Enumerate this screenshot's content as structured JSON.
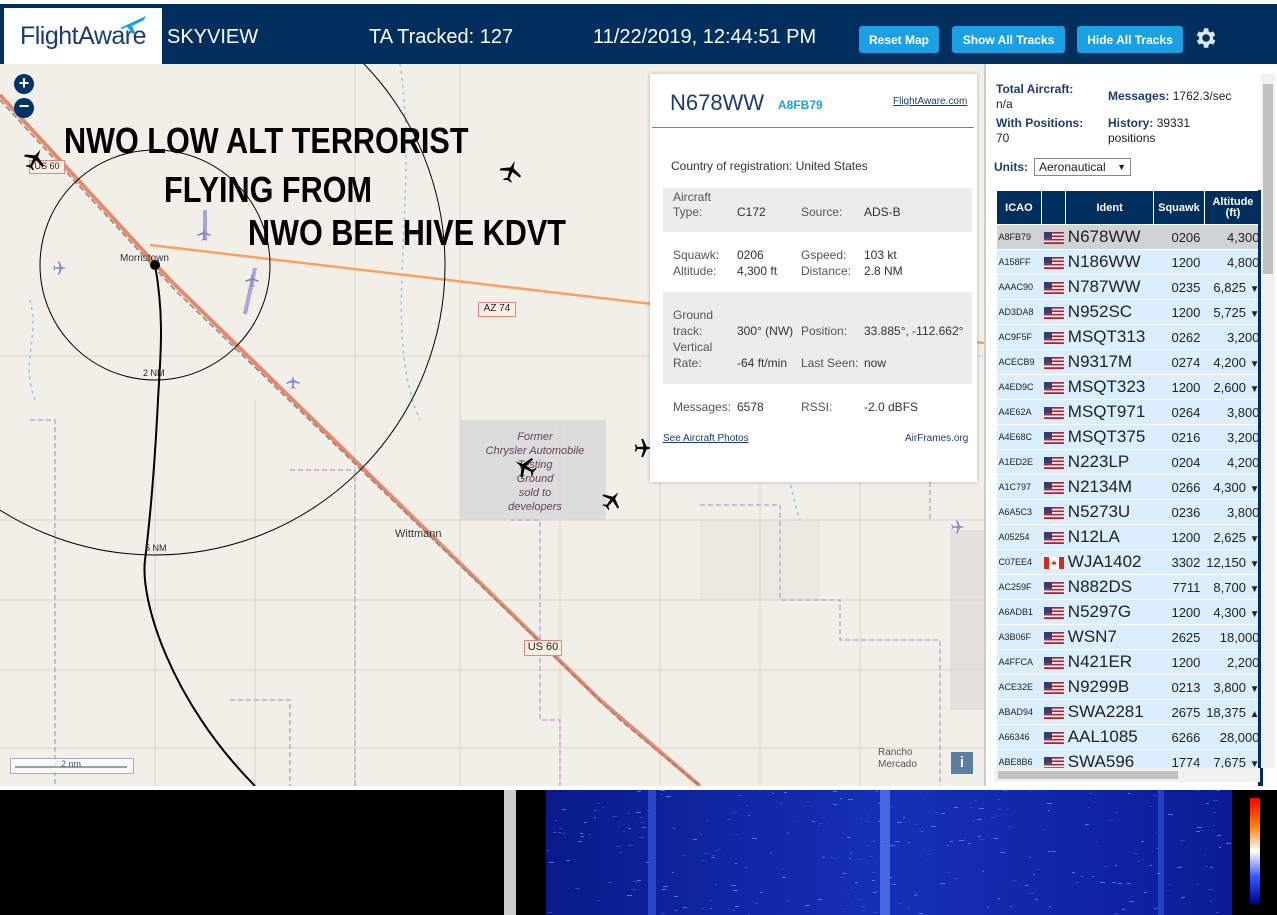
{
  "header": {
    "logo": "FlightAware",
    "title": "SKYVIEW",
    "tracked": "TA Tracked: 127",
    "datetime": "11/22/2019, 12:44:51 PM",
    "buttons": {
      "reset": "Reset Map",
      "show": "Show All Tracks",
      "hide": "Hide All Tracks"
    }
  },
  "map": {
    "overlay_text": [
      "NWO LOW ALT TERRORIST",
      "FLYING FROM",
      "NWO BEE HIVE KDVT"
    ],
    "places": {
      "morristown": "Morristown",
      "wittmann": "Wittmann",
      "rancho": "Rancho",
      "mercado": "Mercado"
    },
    "poi": [
      "Former",
      "Chrysler Automobile",
      "Testing",
      "Ground",
      "sold to",
      "developers"
    ],
    "shields": {
      "us60_top": "US 60",
      "az74": "AZ 74",
      "us60_bottom": "US 60"
    },
    "rings": {
      "r2": "2 NM",
      "r5": "5 NM"
    },
    "scale": "2 nm",
    "info_button": "i"
  },
  "popup": {
    "callsign": "N678WW",
    "icao": "A8FB79",
    "link": "FlightAware.com",
    "country_label": "Country of registration:",
    "country": "United States",
    "aircraft_label": "Aircraft",
    "type_label": "Type:",
    "type": "C172",
    "source_label": "Source:",
    "source": "ADS-B",
    "squawk_label": "Squawk:",
    "squawk": "0206",
    "gspeed_label": "Gspeed:",
    "gspeed": "103 kt",
    "altitude_label": "Altitude:",
    "altitude": "4,300 ft",
    "distance_label": "Distance:",
    "distance": "2.8 NM",
    "ground_label": "Ground",
    "track_label": "track:",
    "track": "300° (NW)",
    "position_label": "Position:",
    "position": "33.885°, -112.662°",
    "vertical_label": "Vertical",
    "rate_label": "Rate:",
    "rate": "-64 ft/min",
    "lastseen_label": "Last Seen:",
    "lastseen": "now",
    "messages_label": "Messages:",
    "messages": "6578",
    "rssi_label": "RSSI:",
    "rssi": "-2.0 dBFS",
    "photos_link": "See Aircraft Photos",
    "airframes_link": "AirFrames.org"
  },
  "panel": {
    "total_label": "Total Aircraft:",
    "total": "n/a",
    "messages_label": "Messages:",
    "messages": "1762.3/sec",
    "withpos_label": "With Positions:",
    "withpos": "70",
    "history_label": "History:",
    "history": "39331",
    "history_unit": "positions",
    "units_label": "Units:",
    "units_value": "Aeronautical",
    "columns": [
      "ICAO",
      "Ident",
      "Squawk",
      "Altitude (ft)"
    ],
    "rows": [
      {
        "icao": "A8FB79",
        "flag": "us",
        "ident": "N678WW",
        "squawk": "0206",
        "alt": "4,300",
        "arrow": ""
      },
      {
        "icao": "A158FF",
        "flag": "us",
        "ident": "N186WW",
        "squawk": "1200",
        "alt": "4,800",
        "arrow": ""
      },
      {
        "icao": "AAAC90",
        "flag": "us",
        "ident": "N787WW",
        "squawk": "0235",
        "alt": "6,825",
        "arrow": "▼"
      },
      {
        "icao": "AD3DA8",
        "flag": "us",
        "ident": "N952SC",
        "squawk": "1200",
        "alt": "5,725",
        "arrow": "▼"
      },
      {
        "icao": "AC9F5F",
        "flag": "us",
        "ident": "MSQT313",
        "squawk": "0262",
        "alt": "3,200",
        "arrow": ""
      },
      {
        "icao": "ACECB9",
        "flag": "us",
        "ident": "N9317M",
        "squawk": "0274",
        "alt": "4,200",
        "arrow": "▼"
      },
      {
        "icao": "A4ED9C",
        "flag": "us",
        "ident": "MSQT323",
        "squawk": "1200",
        "alt": "2,600",
        "arrow": "▼"
      },
      {
        "icao": "A4E62A",
        "flag": "us",
        "ident": "MSQT971",
        "squawk": "0264",
        "alt": "3,800",
        "arrow": ""
      },
      {
        "icao": "A4E68C",
        "flag": "us",
        "ident": "MSQT375",
        "squawk": "0216",
        "alt": "3,200",
        "arrow": ""
      },
      {
        "icao": "A1ED2E",
        "flag": "us",
        "ident": "N223LP",
        "squawk": "0204",
        "alt": "4,200",
        "arrow": ""
      },
      {
        "icao": "A1C797",
        "flag": "us",
        "ident": "N2134M",
        "squawk": "0266",
        "alt": "4,300",
        "arrow": "▼"
      },
      {
        "icao": "A6A5C3",
        "flag": "us",
        "ident": "N5273U",
        "squawk": "0236",
        "alt": "3,800",
        "arrow": ""
      },
      {
        "icao": "A05254",
        "flag": "us",
        "ident": "N12LA",
        "squawk": "1200",
        "alt": "2,625",
        "arrow": "▼"
      },
      {
        "icao": "C07EE4",
        "flag": "ca",
        "ident": "WJA1402",
        "squawk": "3302",
        "alt": "12,150",
        "arrow": "▼"
      },
      {
        "icao": "AC259F",
        "flag": "us",
        "ident": "N882DS",
        "squawk": "7711",
        "alt": "8,700",
        "arrow": "▼"
      },
      {
        "icao": "A6ADB1",
        "flag": "us",
        "ident": "N5297G",
        "squawk": "1200",
        "alt": "4,300",
        "arrow": "▼"
      },
      {
        "icao": "A3B06F",
        "flag": "us",
        "ident": "WSN7",
        "squawk": "2625",
        "alt": "18,000",
        "arrow": ""
      },
      {
        "icao": "A4FFCA",
        "flag": "us",
        "ident": "N421ER",
        "squawk": "1200",
        "alt": "2,200",
        "arrow": ""
      },
      {
        "icao": "ACE32E",
        "flag": "us",
        "ident": "N9299B",
        "squawk": "0213",
        "alt": "3,800",
        "arrow": "▼"
      },
      {
        "icao": "ABAD94",
        "flag": "us",
        "ident": "SWA2281",
        "squawk": "2675",
        "alt": "18,375",
        "arrow": "▲"
      },
      {
        "icao": "A66346",
        "flag": "us",
        "ident": "AAL1085",
        "squawk": "6266",
        "alt": "28,000",
        "arrow": ""
      },
      {
        "icao": "ABE8B6",
        "flag": "us",
        "ident": "SWA596",
        "squawk": "1774",
        "alt": "7,675",
        "arrow": "▼"
      }
    ]
  },
  "colors": {
    "header": "#002f5d",
    "button": "#1ba1e2",
    "row": "#dbeefb",
    "selected_row": "#cfd3d6",
    "highway": "#f4a460",
    "freeway": "#e8886a"
  }
}
